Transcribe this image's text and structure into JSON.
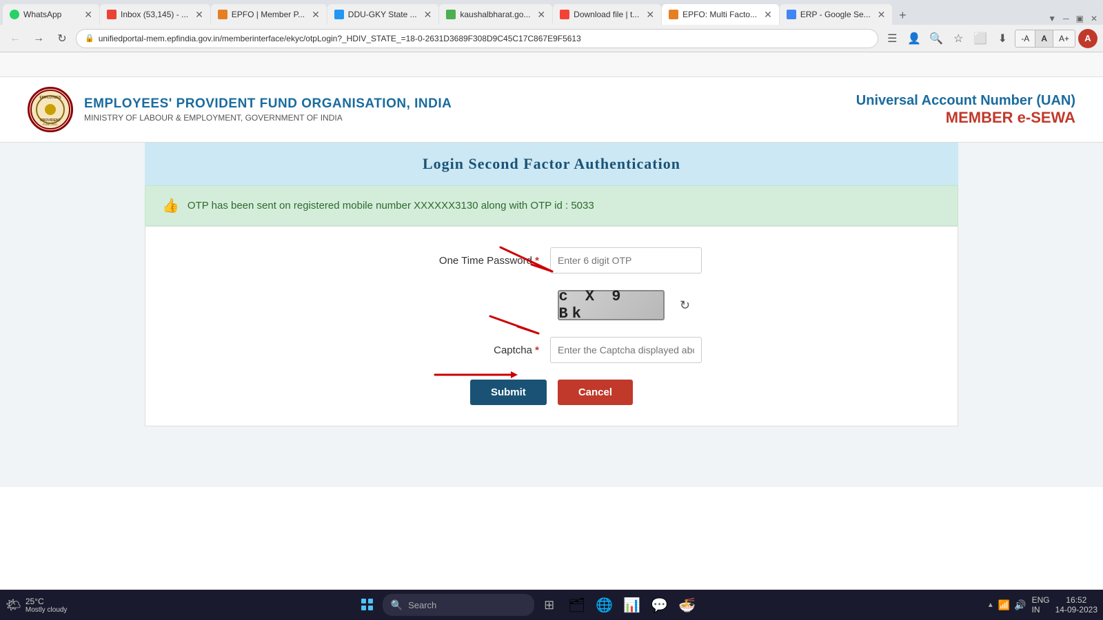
{
  "tabs": [
    {
      "id": "whatsapp",
      "label": "WhatsApp",
      "active": false,
      "icon_color": "#25d366"
    },
    {
      "id": "gmail",
      "label": "Inbox (53,145) - ...",
      "active": false,
      "icon_color": "#ea4335"
    },
    {
      "id": "epfo_member",
      "label": "EPFO | Member P...",
      "active": false,
      "icon_color": "#e67e22"
    },
    {
      "id": "ddu_gky",
      "label": "DDU-GKY State ...",
      "active": false,
      "icon_color": "#2196f3"
    },
    {
      "id": "kaushal",
      "label": "kaushalbharat.go...",
      "active": false,
      "icon_color": "#4caf50"
    },
    {
      "id": "download",
      "label": "Download file | t...",
      "active": false,
      "icon_color": "#f44336"
    },
    {
      "id": "epfo_multi",
      "label": "EPFO: Multi Facto...",
      "active": true,
      "icon_color": "#e67e22"
    },
    {
      "id": "erp",
      "label": "ERP - Google Se...",
      "active": false,
      "icon_color": "#4285f4"
    }
  ],
  "address_bar": {
    "url": "unifiedportal-mem.epfindia.gov.in/memberinterface/ekyc/otpLogin?_HDIV_STATE_=18-0-2631D3689F308D9C45C17C867E9F5613"
  },
  "font_size_controls": {
    "decrease": "-A",
    "normal": "A",
    "increase": "A+"
  },
  "header": {
    "org_name": "EMPLOYEES' PROVIDENT FUND ORGANISATION, INDIA",
    "ministry": "MINISTRY OF LABOUR & EMPLOYMENT, GOVERNMENT OF INDIA",
    "uan_label": "Universal Account Number (UAN)",
    "member_sewa": "MEMBER e-SEWA"
  },
  "page": {
    "title": "Login Second Factor Authentication",
    "otp_message": "OTP has been sent on registered mobile number XXXXXX3130 along with OTP id : 5033",
    "otp_label": "One Time Password",
    "otp_required": "*",
    "otp_placeholder": "Enter 6 digit OTP",
    "captcha_label": "Captcha",
    "captcha_required": "*",
    "captcha_text": "c  X  9  Bk",
    "captcha_placeholder": "Enter the Captcha displayed above",
    "submit_label": "Submit",
    "cancel_label": "Cancel"
  },
  "taskbar": {
    "weather_temp": "25°C",
    "weather_desc": "Mostly cloudy",
    "search_placeholder": "Search",
    "language": "ENG",
    "language2": "IN",
    "time": "16:52",
    "date": "14-09-2023"
  }
}
